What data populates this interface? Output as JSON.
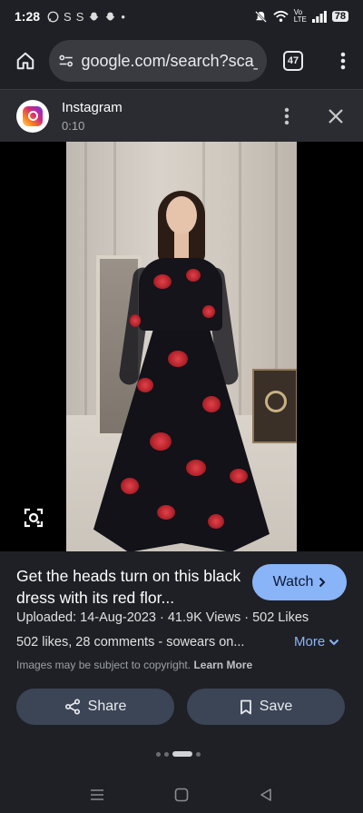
{
  "status_bar": {
    "time": "1:28",
    "notification_icons": [
      "whatsapp-icon",
      "S",
      "S",
      "snapchat-icon",
      "snapchat-icon",
      "•"
    ],
    "network": "Vo LTE",
    "battery": "78"
  },
  "browser": {
    "url": "google.com/search?sca_",
    "tab_count": "47",
    "icons": [
      "home-icon",
      "site-settings-icon",
      "tab-switcher-icon",
      "more-vert-icon"
    ]
  },
  "source": {
    "name": "Instagram",
    "duration": "0:10",
    "icons": [
      "instagram-logo",
      "more-vert-icon",
      "close-icon"
    ]
  },
  "result": {
    "title": "Get the heads turn on this black dress with its red flor...",
    "watch_label": "Watch",
    "stats": "Uploaded: 14-Aug-2023 · 41.9K Views · 502 Likes",
    "description": "502 likes, 28 comments - sowears on...",
    "more_label": "More",
    "copyright_text": "Images may be subject to copyright.",
    "learn_more": "Learn More",
    "share_label": "Share",
    "save_label": "Save"
  },
  "colors": {
    "background": "#1f2025",
    "accent_blue": "#8ab4f8",
    "button_bg": "#3c4556"
  }
}
